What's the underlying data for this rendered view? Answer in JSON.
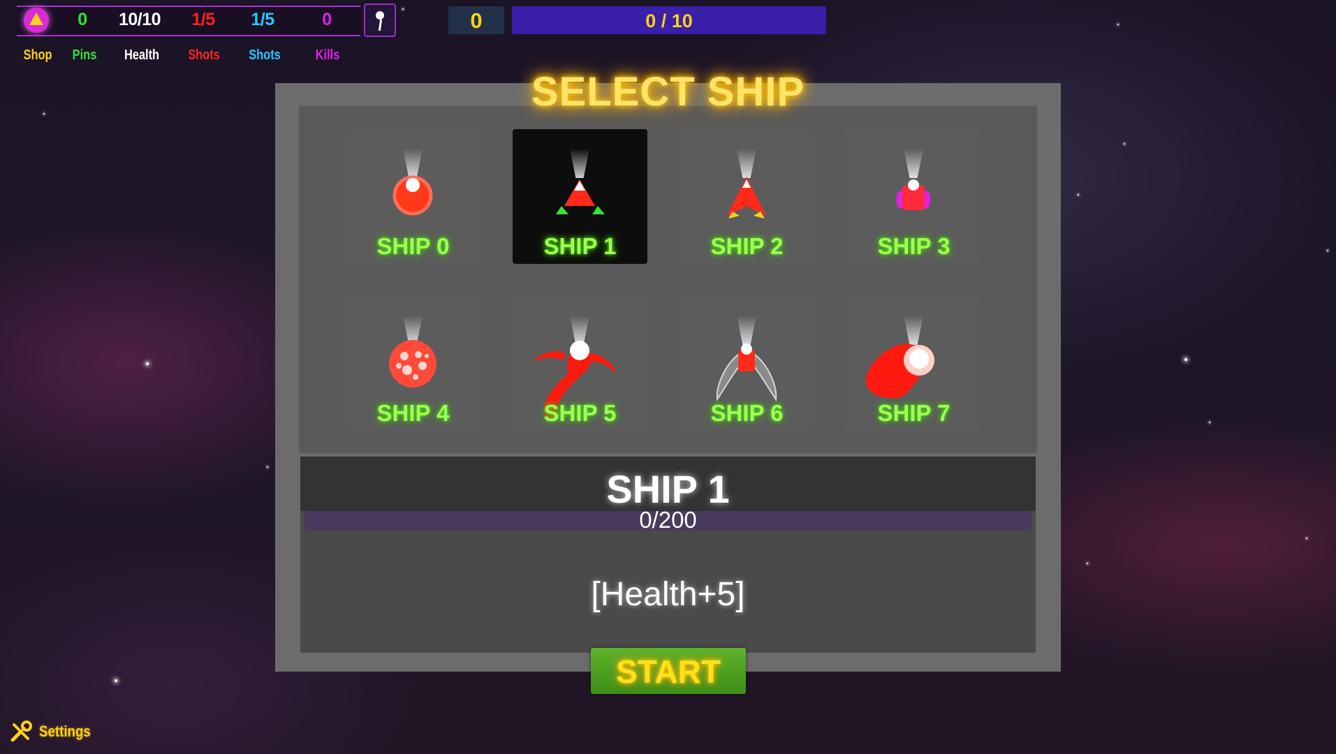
{
  "hud": {
    "pins": "0",
    "health": "10/10",
    "shots_red": "1/5",
    "shots_blue": "1/5",
    "kills": "0",
    "labels": {
      "shop": "Shop",
      "pins": "Pins",
      "health": "Health",
      "shots_red": "Shots",
      "shots_blue": "Shots",
      "kills": "Kills"
    },
    "score": "0",
    "progress": "0 / 10",
    "progress_fraction": 0
  },
  "title": "SELECT SHIP",
  "ships": [
    {
      "label": "SHIP 0",
      "icon": "red-orb-ship-icon",
      "selected": false
    },
    {
      "label": "SHIP 1",
      "icon": "triangle-ship-icon",
      "selected": true
    },
    {
      "label": "SHIP 2",
      "icon": "arrow-ship-icon",
      "selected": false
    },
    {
      "label": "SHIP 3",
      "icon": "magenta-ship-icon",
      "selected": false
    },
    {
      "label": "SHIP 4",
      "icon": "spotted-sphere-ship-icon",
      "selected": false
    },
    {
      "label": "SHIP 5",
      "icon": "tentacle-ship-icon",
      "selected": false
    },
    {
      "label": "SHIP 6",
      "icon": "winged-ship-icon",
      "selected": false
    },
    {
      "label": "SHIP 7",
      "icon": "red-blob-ship-icon",
      "selected": false
    }
  ],
  "info": {
    "name": "SHIP 1",
    "progress": "0/200",
    "progress_fraction": 0,
    "bonus": "[Health+5]"
  },
  "start_label": "START",
  "settings_label": "Settings",
  "colors": {
    "accent_yellow": "#ffd21a",
    "ship_label_green": "#9eff52",
    "hud_purple": "#b02ad6",
    "progress_bar": "#3a1fa8"
  }
}
